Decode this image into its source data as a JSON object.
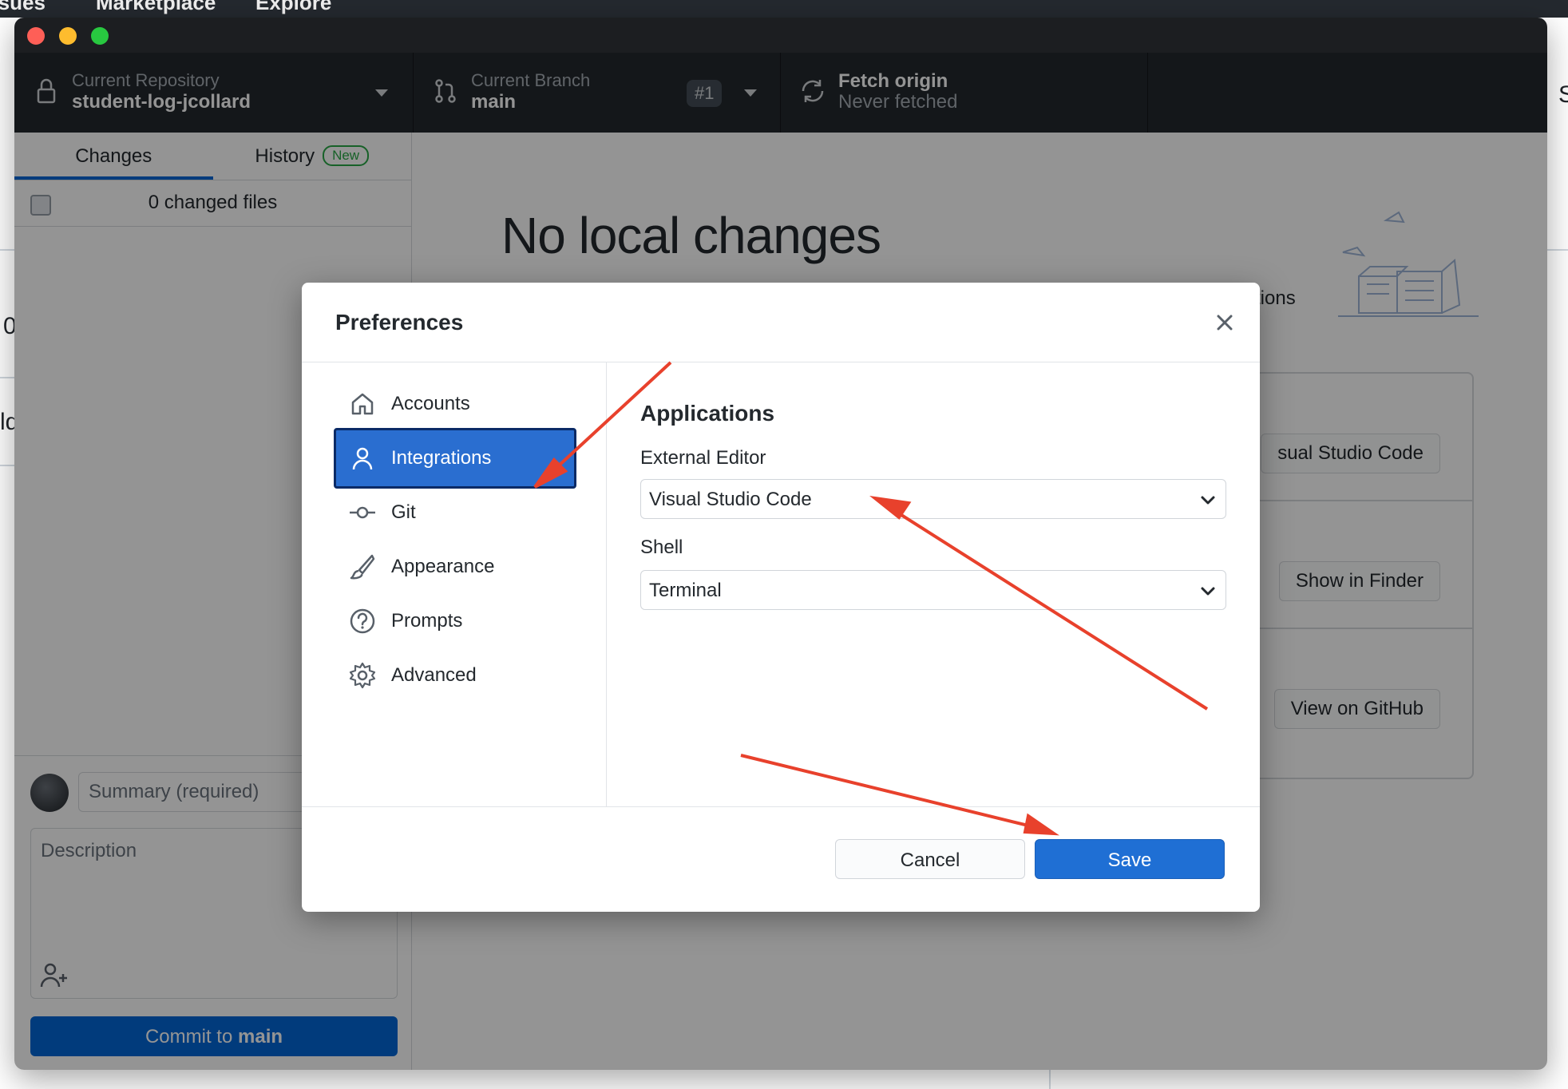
{
  "browser_menu": {
    "items": [
      "Issues",
      "Marketplace",
      "Explore"
    ]
  },
  "background_page": {
    "fragments": [
      "0",
      "ld",
      "S"
    ]
  },
  "toolbar": {
    "repo_label": "Current Repository",
    "repo_value": "student-log-jcollard",
    "branch_label": "Current Branch",
    "branch_value": "main",
    "pr_badge": "#1",
    "fetch_label": "Fetch origin",
    "fetch_status": "Never fetched"
  },
  "sidebar": {
    "tabs": [
      {
        "label": "Changes"
      },
      {
        "label": "History",
        "badge": "New"
      }
    ],
    "changed_files": "0 changed files",
    "summary_placeholder": "Summary (required)",
    "description_placeholder": "Description",
    "commit_prefix": "Commit to",
    "commit_branch": "main"
  },
  "main": {
    "title": "No local changes",
    "subtitle_fragment": "stions",
    "suggestions": [
      "sual Studio Code",
      "Show in Finder",
      "View on GitHub"
    ]
  },
  "dialog": {
    "title": "Preferences",
    "nav": [
      "Accounts",
      "Integrations",
      "Git",
      "Appearance",
      "Prompts",
      "Advanced"
    ],
    "selected_nav": "Integrations",
    "section_title": "Applications",
    "external_editor_label": "External Editor",
    "external_editor_value": "Visual Studio Code",
    "shell_label": "Shell",
    "shell_value": "Terminal",
    "cancel_label": "Cancel",
    "save_label": "Save"
  },
  "colors": {
    "accent": "#1f6fd4",
    "selected_nav_border": "#0a2a66",
    "annotation_arrow": "#e8412c",
    "history_badge": "#28a745"
  }
}
